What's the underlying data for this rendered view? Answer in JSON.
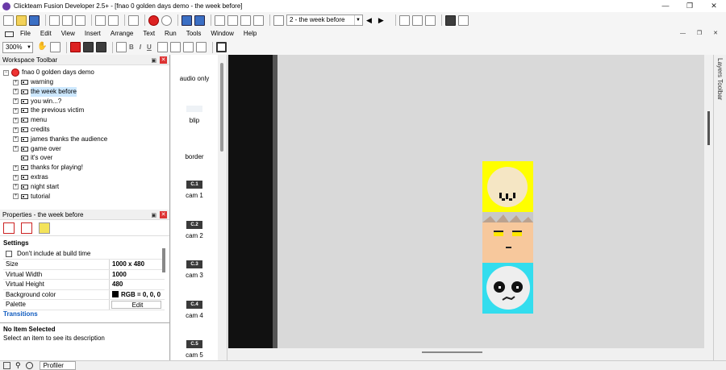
{
  "window": {
    "title": "Clickteam Fusion Developer 2.5+ - [fnao 0 golden days demo - the week before]",
    "controls": [
      "—",
      "❐",
      "✕"
    ]
  },
  "toolbar": {
    "frame_select": "2 - the week before"
  },
  "menu": {
    "items": [
      "File",
      "Edit",
      "View",
      "Insert",
      "Arrange",
      "Text",
      "Run",
      "Tools",
      "Window",
      "Help"
    ]
  },
  "format_toolbar": {
    "zoom": "300%",
    "bold": "B",
    "italic": "I",
    "underline": "U"
  },
  "workspace": {
    "title": "Workspace Toolbar",
    "app_name": "fnao 0 golden days demo",
    "frames": [
      {
        "label": "warning",
        "expand": "+"
      },
      {
        "label": "the week before",
        "expand": "+"
      },
      {
        "label": "you win...?",
        "expand": "+"
      },
      {
        "label": "the previous victim",
        "expand": "+"
      },
      {
        "label": "menu",
        "expand": "+"
      },
      {
        "label": "credits",
        "expand": "+"
      },
      {
        "label": "james thanks the audience",
        "expand": "+"
      },
      {
        "label": "game over",
        "expand": "+"
      },
      {
        "label": "it's over",
        "expand": ""
      },
      {
        "label": "thanks for playing!",
        "expand": "+"
      },
      {
        "label": "extras",
        "expand": "+"
      },
      {
        "label": "night start",
        "expand": "+"
      },
      {
        "label": "tutorial",
        "expand": "+"
      }
    ]
  },
  "properties": {
    "title": "Properties - the week before",
    "group_settings": "Settings",
    "dont_include": "Don't include at build time",
    "rows": [
      {
        "name": "Size",
        "value": "1000 x 480"
      },
      {
        "name": "Virtual Width",
        "value": "1000"
      },
      {
        "name": "Virtual Height",
        "value": "480"
      },
      {
        "name": "Background color",
        "value": "RGB = 0, 0, 0"
      },
      {
        "name": "Palette",
        "value": "Edit"
      }
    ],
    "group_transitions": "Transitions"
  },
  "description": {
    "title": "No Item Selected",
    "text": "Select an item to see its description"
  },
  "status": {
    "profiler": "Profiler"
  },
  "objects": {
    "items": [
      "audio only",
      "blip",
      "border",
      "cam 1",
      "cam 2",
      "cam 3",
      "cam 4",
      "cam 5"
    ],
    "cam_icons": [
      "C.1",
      "C.2",
      "C.3",
      "C.4",
      "C.5"
    ]
  },
  "layers": {
    "label": "Layers Toolbar"
  },
  "colors": {
    "yellow_face_bg": "#ffff00",
    "orange_face_bg": "#f7c89c",
    "cyan_face_bg": "#33ddee"
  }
}
